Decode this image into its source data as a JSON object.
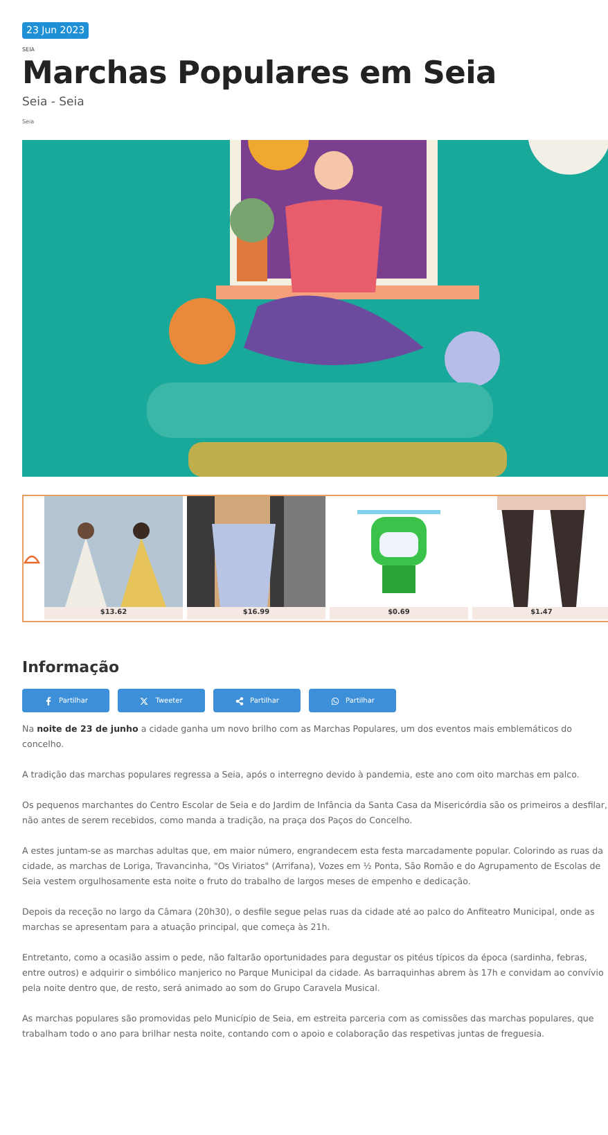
{
  "date_badge": "23 Jun 2023",
  "category": "SEIA",
  "title": "Marchas Populares em Seia",
  "location": "Seia - Seia",
  "place": "Seia",
  "ad": {
    "products": [
      {
        "price": "$13.62"
      },
      {
        "price": "$16.99"
      },
      {
        "price": "$0.69"
      },
      {
        "price": "$1.47"
      }
    ]
  },
  "section_title": "Informação",
  "share_buttons": [
    {
      "kind": "facebook",
      "label": "Partilhar"
    },
    {
      "kind": "x",
      "label": "Tweeter"
    },
    {
      "kind": "share",
      "label": "Partilhar"
    },
    {
      "kind": "whatsapp",
      "label": "Partilhar"
    }
  ],
  "paragraphs": [
    "Na **noite de 23 de junho** a cidade ganha um novo brilho com as Marchas Populares, um dos eventos mais emblemáticos do concelho.",
    "A tradição das marchas populares regressa a Seia, após o interregno devido à pandemia, este ano com oito marchas em palco.",
    "Os pequenos marchantes do Centro Escolar de Seia e do Jardim de Infância da Santa Casa da Misericórdia são os primeiros a desfilar, não antes de serem recebidos, como manda a tradição, na praça dos Paços do Concelho.",
    "A estes juntam-se as marchas adultas que, em maior número, engrandecem esta festa marcadamente popular. Colorindo as ruas da cidade, as marchas de Loriga, Travancinha, \"Os Viriatos\" (Arrifana), Vozes em ½ Ponta, São Romão e do Agrupamento de Escolas de Seia vestem orgulhosamente esta noite o fruto do trabalho de largos meses de empenho e dedicação.",
    "Depois da receção no largo da Câmara (20h30), o desfile segue pelas ruas da cidade até ao palco do Anfiteatro Municipal, onde as marchas se apresentam para a atuação principal, que começa às 21h.",
    "Entretanto, como a ocasião assim o pede, não faltarão oportunidades para degustar os pitéus típicos da época (sardinha, febras, entre outros) e adquirir o simbólico manjerico no Parque Municipal da cidade. As barraquinhas abrem às 17h e convidam ao convívio pela noite dentro que, de resto, será animado ao som do Grupo Caravela Musical.",
    "As marchas populares são promovidas pelo Município de Seia, em estreita parceria com as comissões das marchas populares, que trabalham todo o ano para brilhar nesta noite, contando com o apoio e colaboração das respetivas juntas de freguesia."
  ]
}
